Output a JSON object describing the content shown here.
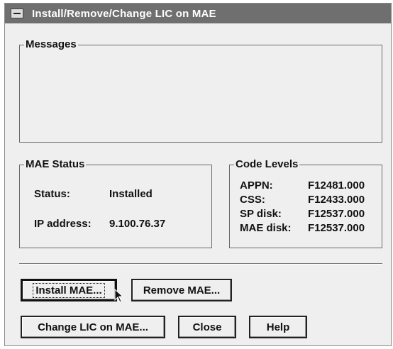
{
  "window": {
    "title": "Install/Remove/Change LIC on MAE"
  },
  "messages": {
    "label": "Messages"
  },
  "mae_status": {
    "label": "MAE Status",
    "status_label": "Status:",
    "status_value": "Installed",
    "ip_label": "IP address:",
    "ip_value": "9.100.76.37"
  },
  "code_levels": {
    "label": "Code Levels",
    "rows": [
      {
        "name": "APPN:",
        "value": "F12481.000"
      },
      {
        "name": "CSS:",
        "value": "F12433.000"
      },
      {
        "name": "SP disk:",
        "value": "F12537.000"
      },
      {
        "name": "MAE disk:",
        "value": "F12537.000"
      }
    ]
  },
  "buttons": {
    "install": "Install MAE...",
    "remove": "Remove MAE...",
    "change": "Change LIC on MAE...",
    "close": "Close",
    "help": "Help"
  },
  "icons": {
    "system_menu": "system-menu-icon",
    "cursor": "mouse-pointer-icon"
  },
  "colors": {
    "titlebar": "#6f6f6f",
    "window_bg": "#efefef"
  }
}
